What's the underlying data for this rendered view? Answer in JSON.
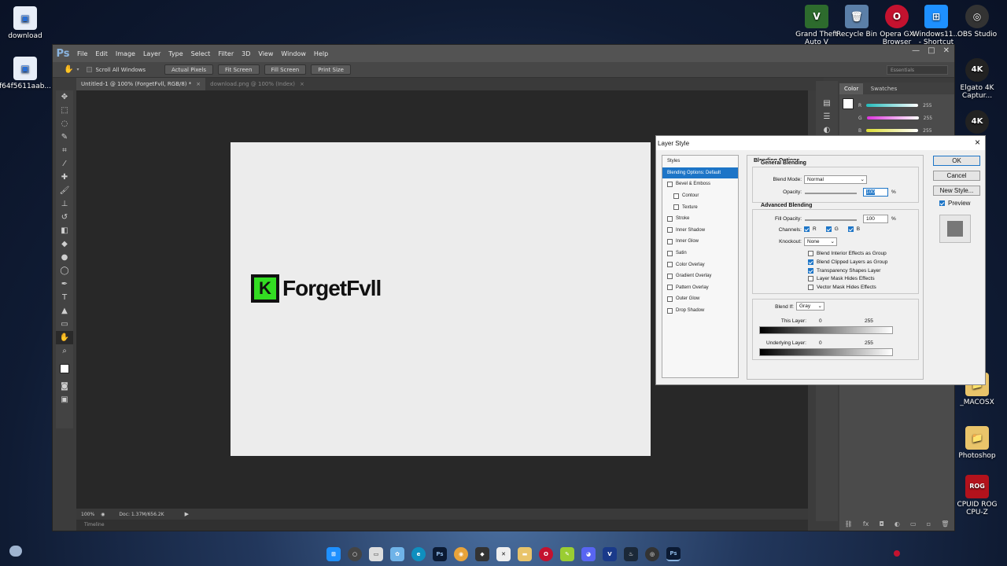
{
  "desktop": {
    "left_icons": [
      "download",
      "f64f5611aab..."
    ],
    "right_icons": [
      {
        "label": "Grand Theft Auto V",
        "color": "#2d6b2d",
        "glyph": "V"
      },
      {
        "label": "Recycle Bin",
        "color": "#5b7fa8",
        "glyph": "🗑"
      },
      {
        "label": "Opera GX Browser",
        "color": "#c4122f",
        "glyph": "O"
      },
      {
        "label": "Windows11... - Shortcut",
        "color": "#1e90ff",
        "glyph": "⊞"
      },
      {
        "label": "OBS Studio",
        "color": "#333",
        "glyph": "◎"
      }
    ],
    "side_icons": [
      {
        "label": "Elgato 4K Captur...",
        "glyph": "4K"
      },
      {
        "label": "_MACOSX",
        "glyph": "📁"
      },
      {
        "label": "Photoshop",
        "glyph": "📁"
      },
      {
        "label": "CPUID ROG CPU-Z",
        "glyph": "ROG"
      }
    ]
  },
  "photoshop": {
    "logo": "Ps",
    "menu": [
      "File",
      "Edit",
      "Image",
      "Layer",
      "Type",
      "Select",
      "Filter",
      "3D",
      "View",
      "Window",
      "Help"
    ],
    "options": {
      "scroll_all": "Scroll All Windows",
      "buttons": [
        "Actual Pixels",
        "Fit Screen",
        "Fill Screen",
        "Print Size"
      ],
      "workspace": "Essentials"
    },
    "tabs": [
      "Untitled-1 @ 100% (ForgetFvll, RGB/8) *",
      "download.png @ 100% (Index)"
    ],
    "canvas_logo": {
      "letter": "K",
      "text": "ForgetFvll"
    },
    "status": {
      "zoom": "100%",
      "doc": "Doc: 1.37M/656.2K"
    },
    "timeline": "Timeline",
    "color_panel": {
      "tabs": [
        "Color",
        "Swatches"
      ],
      "channels": [
        {
          "name": "R",
          "value": "255",
          "color": "#7fd9d9"
        },
        {
          "name": "G",
          "value": "255",
          "color": "#e070e0"
        },
        {
          "name": "B",
          "value": "255",
          "color": "#e0e070"
        }
      ]
    }
  },
  "dialog": {
    "title": "Layer Style",
    "styles_header": "Styles",
    "styles": [
      {
        "label": "Blending Options: Default",
        "selected": true,
        "checkbox": false,
        "indent": false
      },
      {
        "label": "Bevel & Emboss",
        "checkbox": true,
        "indent": false
      },
      {
        "label": "Contour",
        "checkbox": true,
        "indent": true
      },
      {
        "label": "Texture",
        "checkbox": true,
        "indent": true
      },
      {
        "label": "Stroke",
        "checkbox": true,
        "indent": false
      },
      {
        "label": "Inner Shadow",
        "checkbox": true,
        "indent": false
      },
      {
        "label": "Inner Glow",
        "checkbox": true,
        "indent": false
      },
      {
        "label": "Satin",
        "checkbox": true,
        "indent": false
      },
      {
        "label": "Color Overlay",
        "checkbox": true,
        "indent": false
      },
      {
        "label": "Gradient Overlay",
        "checkbox": true,
        "indent": false
      },
      {
        "label": "Pattern Overlay",
        "checkbox": true,
        "indent": false
      },
      {
        "label": "Outer Glow",
        "checkbox": true,
        "indent": false
      },
      {
        "label": "Drop Shadow",
        "checkbox": true,
        "indent": false
      }
    ],
    "blending": {
      "title": "Blending Options",
      "general": "General Blending",
      "blend_mode_label": "Blend Mode:",
      "blend_mode": "Normal",
      "opacity_label": "Opacity:",
      "opacity": "100",
      "advanced": "Advanced Blending",
      "fill_label": "Fill Opacity:",
      "fill": "100",
      "percent": "%",
      "channels_label": "Channels:",
      "channels": [
        "R",
        "G",
        "B"
      ],
      "knockout_label": "Knockout:",
      "knockout": "None",
      "checks": [
        {
          "label": "Blend Interior Effects as Group",
          "checked": false
        },
        {
          "label": "Blend Clipped Layers as Group",
          "checked": true
        },
        {
          "label": "Transparency Shapes Layer",
          "checked": true
        },
        {
          "label": "Layer Mask Hides Effects",
          "checked": false
        },
        {
          "label": "Vector Mask Hides Effects",
          "checked": false
        }
      ],
      "blend_if_label": "Blend If:",
      "blend_if": "Gray",
      "this_layer": "This Layer:",
      "underlying": "Underlying Layer:",
      "min": "0",
      "max": "255"
    },
    "buttons": {
      "ok": "OK",
      "cancel": "Cancel",
      "new_style": "New Style...",
      "preview": "Preview"
    }
  }
}
